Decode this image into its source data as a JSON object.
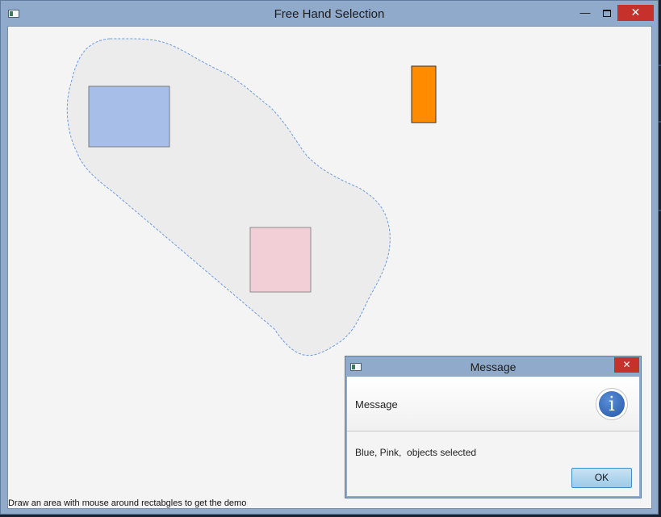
{
  "window": {
    "title": "Free Hand Selection",
    "minimize_glyph": "—",
    "close_glyph": "✕"
  },
  "canvas": {
    "selection_fill": "#ececec",
    "selection_stroke": "#6b9be0",
    "rectangles": [
      {
        "name": "Blue",
        "fill": "#a7bfe8",
        "stroke": "#7b7b7b"
      },
      {
        "name": "Pink",
        "fill": "#f2cfd6",
        "stroke": "#8c8c8c"
      },
      {
        "name": "Orange",
        "fill": "#ff8c00",
        "stroke": "#333333"
      }
    ]
  },
  "status": {
    "hint": "Draw an area with mouse around rectabgles to get the demo"
  },
  "dialog": {
    "title": "Message",
    "close_glyph": "✕",
    "header": "Message",
    "info_glyph": "i",
    "content": "Blue, Pink,  objects selected",
    "ok_label": "OK"
  }
}
